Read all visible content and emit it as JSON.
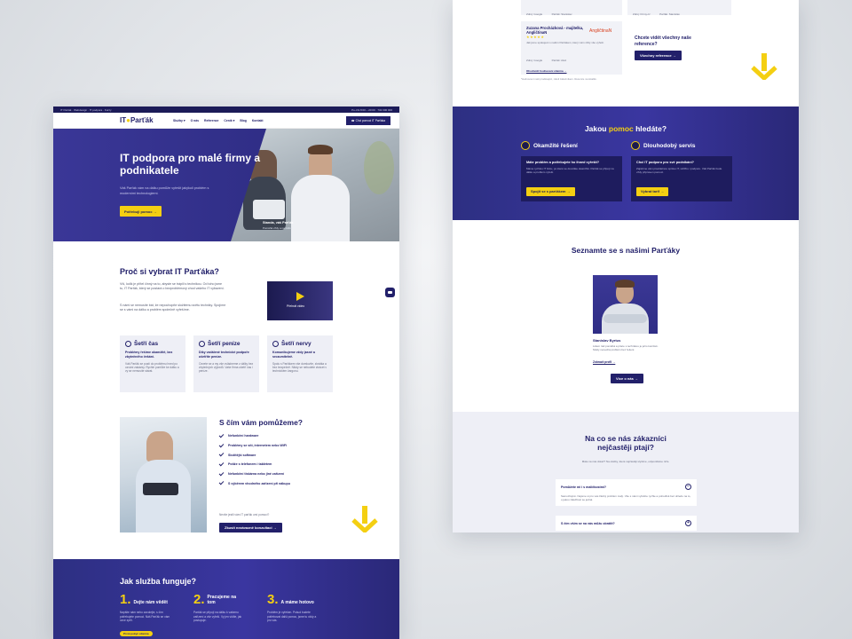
{
  "left": {
    "topbar": {
      "left": "IT Parťák · Webdesign · IT podpora · Kurzy",
      "right": "Po–Pá 8:00 – 20:00 · 732 000 000"
    },
    "logo": {
      "main": "IT",
      "dot": "●",
      "rest": "Parťák"
    },
    "nav": [
      "Služby ▾",
      "O nás",
      "Reference",
      "Ceník ▾",
      "Blog",
      "Kontakt"
    ],
    "nav_cta": "☎ Chci pomoci IT Parťáka",
    "hero": {
      "title": "IT podpora pro malé firmy a podnikatele",
      "text": "Váš Parťák vám na dálku pomůže vyřešit jakýkoli problém s moderními technologiemi.",
      "button": "Potřebuji pomoc →",
      "caption": "Standa, váš Parťák",
      "caption_sub": "Pomáhá vždy a na dálku"
    },
    "why": {
      "title": "Proč si vybrat IT Parťáka?",
      "p1": "Víš, kolik je přítel činný na to, abyste se trápili s technikou. Od toho jsme tu, IT Parťák, který se postará o bezproblémový chod vašeho IT vybavení.",
      "p2": "S námi se nemusíte bát, že nepochopíte složitému světu techniky. Spojíme se s vámi na dálku a problém společně vyřešíme.",
      "video_label": "Přehrát video"
    },
    "cards": [
      {
        "title": "Šetří čas",
        "bold": "Problémy řešíme okamžitě, bez zbytečného čekání.",
        "text": "Váš Parťák se pustí do problému hned po ozvání zakázky. Rychle pomůže ke dálku a vy se nemusíte starat."
      },
      {
        "title": "Šetří peníze",
        "bold": "Díky vzdálené technické podpoře ušetříte peníze.",
        "text": "Ozvete se a my vše zvládneme z dálky bez zbytečných výjezdů. Vaše firma ušetří čas i peníze."
      },
      {
        "title": "Šetří nervy",
        "bold": "Komunikujeme vždy jasně a srozumitelně.",
        "text": "Spolu s Parťákem vše domluvíte, zkrátka a bez bezpečně. Nikdy se nebudete ztrácet v technickém žargonu."
      }
    ],
    "help": {
      "title": "S čím vám pomůžeme?",
      "items": [
        "Nefunkční hardware",
        "Problémy se sítí, internetem nebo WiFi",
        "Složitější software",
        "Potíže s telefonem i tabletem",
        "Nefunkční tiskárna nebo jiné zařízení",
        "S výběrem vhodného zařízení při nákupu"
      ],
      "note": "Nevíte jestli vám IT parťák umí pomoci?",
      "button": "Zkusit nezávazně konzultaci →"
    },
    "how": {
      "title": "Jak služba funguje?",
      "steps": [
        {
          "n": "1.",
          "h": "Dejte nám vědět",
          "t": "Napište nám nebo zavolejte, s čím potřebujete pomoci. Náš Parťák se vám ozve zpět.",
          "tag": "První pokyn zdarma"
        },
        {
          "n": "2.",
          "h": "Pracujeme na tom",
          "t": "Parťák se připojí na dálku k vašemu zařízení a vše vyřeší. Vy jen vidíte, jak postupuje.",
          "tag": ""
        },
        {
          "n": "3.",
          "h": "A máme hotovo",
          "t": "Problém je vyřešen. Pokud budete potřebovat další pomoc, jsme tu vždy a pro vás.",
          "tag": ""
        }
      ]
    }
  },
  "right": {
    "reviews_top": [
      {
        "src": "Zdroj: Google",
        "who": "Parťák: Stanislav"
      },
      {
        "src": "Zdroj: Firmy.cz",
        "who": "Parťák: Stanislav"
      }
    ],
    "review": {
      "name": "Zuzana Procházková - majitelka, AngličtinaN",
      "stars": "★★★★★",
      "text": "Jak jsme spokojeni s naším Parťákem, který nám vždy vše vyřeší.",
      "src": "Zdroj: Google",
      "who": "Parťák: Aleš",
      "brand": "AngličtinaN",
      "link": "Ohodnotit hodnocení zdarma →"
    },
    "want": "Chcete vidět všechny naše reference?",
    "want_btn": "Všechny reference →",
    "footnote": "*Hodnocení naší prodávající, nikoli zákazníkem. Recenze na lokalitě.",
    "pomoc": {
      "title_a": "Jakou ",
      "title_b": "pomoc",
      "title_c": " hledáte?",
      "cols": [
        {
          "h": "Okamžité řešení",
          "bh": "Máte problém a potřebujete ho ihned vyřešit?",
          "bt": "Máme rychlou IT linku, po které se dovoláte okamžitě. Parťák se připojí na dálku a problém vyřeší.",
          "btn": "Spojit se s parťákem →"
        },
        {
          "h": "Dlouhodobý servis",
          "bh": "Chci IT podporu pro své podnikání?",
          "bt": "Zajistíme vám pravidelnou správu IT, údržbu i podporu. Váš Parťák bude vždy připraven pomoci.",
          "btn": "Vybrat tarif →"
        }
      ]
    },
    "team": {
      "title": "Seznamte se s našimi Parťáky",
      "name": "Stanislav Byrtus",
      "text": "Lidem rád pomáhá a práce s technikou je jeho koníček. Nikdy nenechá problém bez řešení.",
      "link": "Zobrazit profil →",
      "button": "Více o nás →"
    },
    "faq": {
      "title": "Na co se nás zákazníci nejčastěji ptají?",
      "sub": "Máte na nás dotaz? Na otázky, které nejčastěji slyšíme, odpovídáme níže.",
      "q1": "Pomůžete mi i s maličkostmi?",
      "a1": "Samozřejmě. Nejsme si pro vás žádný problém malý. Vše s námi vyřešíte rychle a pohodlně bez ohledu na to, o jakou záležitost se jedná.",
      "q2": "S čím vším se na vás můžu obrátit?",
      "ic1": "−",
      "ic2": "+"
    }
  }
}
